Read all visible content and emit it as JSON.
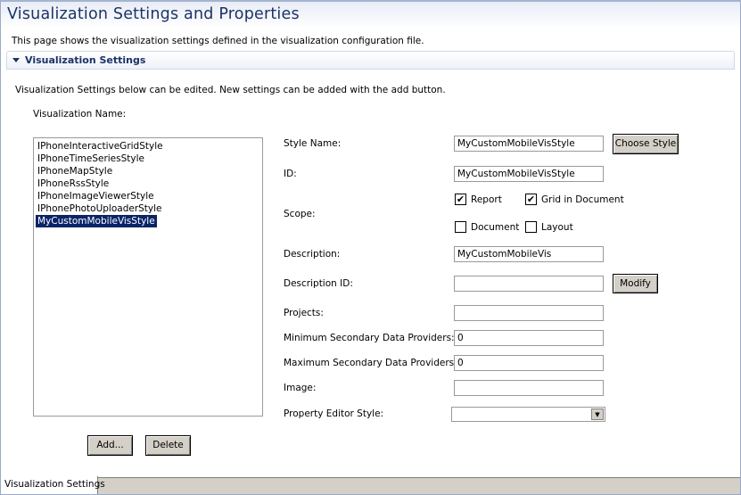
{
  "page": {
    "title": "Visualization Settings and Properties",
    "description": "This page shows the visualization settings defined in the visualization configuration file."
  },
  "section": {
    "title": "Visualization Settings",
    "intro": "Visualization Settings below can be edited. New settings can be added with the add button.",
    "list_label": "Visualization Name:",
    "items": [
      "IPhoneInteractiveGridStyle",
      "IPhoneTimeSeriesStyle",
      "IPhoneMapStyle",
      "IPhoneRssStyle",
      "IPhoneImageViewerStyle",
      "IPhonePhotoUploaderStyle",
      "MyCustomMobileVisStyle"
    ],
    "selected": "MyCustomMobileVisStyle",
    "add_label": "Add...",
    "delete_label": "Delete"
  },
  "form": {
    "style_name": {
      "label": "Style Name:",
      "value": "MyCustomMobileVisStyle",
      "button": "Choose Style"
    },
    "id": {
      "label": "ID:",
      "value": "MyCustomMobileVisStyle"
    },
    "scope": {
      "label": "Scope:",
      "options": [
        {
          "label": "Report",
          "checked": true
        },
        {
          "label": "Grid in Document",
          "checked": true
        },
        {
          "label": "Document",
          "checked": false
        },
        {
          "label": "Layout",
          "checked": false
        }
      ]
    },
    "description": {
      "label": "Description:",
      "value": "MyCustomMobileVis"
    },
    "description_id": {
      "label": "Description ID:",
      "value": "",
      "button": "Modify"
    },
    "projects": {
      "label": "Projects:",
      "value": ""
    },
    "min_providers": {
      "label": "Minimum Secondary Data Providers:",
      "value": "0"
    },
    "max_providers": {
      "label": "Maximum Secondary Data Providers:",
      "value": "0"
    },
    "image": {
      "label": "Image:",
      "value": ""
    },
    "property_editor_style": {
      "label": "Property Editor Style:",
      "value": ""
    }
  },
  "bottom_tab": {
    "label": "Visualization Settings"
  }
}
